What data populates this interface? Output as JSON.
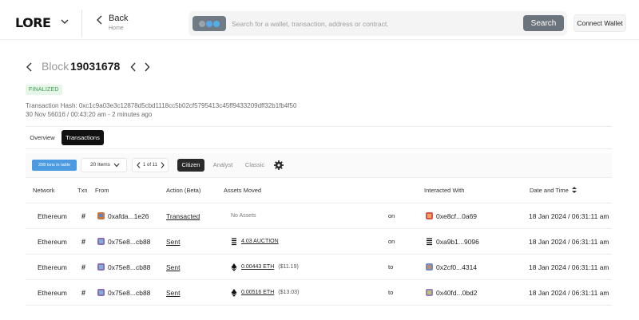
{
  "header": {
    "logo": "LORE",
    "back_label": "Back",
    "back_sub": "Home",
    "search_placeholder": "Search for a wallet, transaction, address or contract.",
    "search_button": "Search",
    "connect_wallet": "Connect Wallet",
    "chain_colors": [
      "#9aa4ad",
      "#5aa7e8",
      "#4fb0e8"
    ]
  },
  "block": {
    "label": "Block",
    "number": "19031678",
    "status": "FINALIZED",
    "tx_hash": "Transaction Hash: 0xc1c9a03e3c12878d5cbd1118cc5b02cf5795413c45ff9433209dff32b1fb4f50",
    "time": "30 Nov 56016 / 00:43:20 am - 2 minutes ago"
  },
  "tabs": [
    {
      "label": "Overview",
      "active": false
    },
    {
      "label": "Transactions",
      "active": true
    }
  ],
  "filters": {
    "txn_count": "208 txns in table",
    "items": "20 Items",
    "pager": "1 of 11",
    "views": [
      "Citizen",
      "Analyst",
      "Classic"
    ],
    "active_view": "Citizen"
  },
  "table": {
    "columns": [
      "Network",
      "Txn",
      "From",
      "Action (Beta)",
      "Assets Moved",
      "Interacted With",
      "Date and Time"
    ],
    "rows": [
      {
        "network": "Ethereum",
        "txn": "#",
        "from": "0xafda...1e26",
        "action": "Transacted",
        "assets": "No Assets",
        "assets_usd": "",
        "asset_icon": "none",
        "direction": "on",
        "interacted": "0xe8cf...0a69",
        "date": "18 Jan 2024 / 06:31:11 am"
      },
      {
        "network": "Ethereum",
        "txn": "#",
        "from": "0x75e8...cb88",
        "action": "Sent",
        "assets": "4.03 AUCTION",
        "assets_usd": "",
        "asset_icon": "auction-icon",
        "direction": "on",
        "interacted": "0xa9b1...9096",
        "date": "18 Jan 2024 / 06:31:11 am"
      },
      {
        "network": "Ethereum",
        "txn": "#",
        "from": "0x75e8...cb88",
        "action": "Sent",
        "assets": "0.00443 ETH",
        "assets_usd": "($11.19)",
        "asset_icon": "eth-icon",
        "direction": "to",
        "interacted": "0x2cf0...4314",
        "date": "18 Jan 2024 / 06:31:11 am"
      },
      {
        "network": "Ethereum",
        "txn": "#",
        "from": "0x75e8...cb88",
        "action": "Sent",
        "assets": "0.00516 ETH",
        "assets_usd": "($13.03)",
        "asset_icon": "eth-icon",
        "direction": "to",
        "interacted": "0x40fd...0bd2",
        "date": "18 Jan 2024 / 06:31:11 am"
      }
    ]
  }
}
